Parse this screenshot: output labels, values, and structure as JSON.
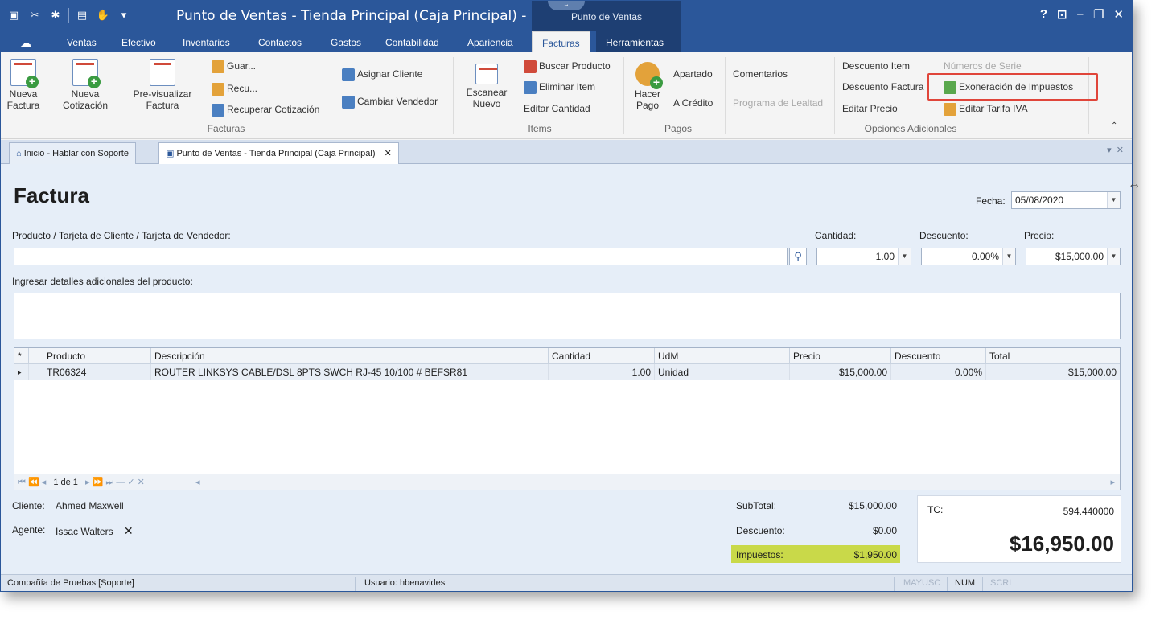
{
  "window": {
    "title": "Punto de Ventas - Tienda Principal (Caja Principal) - Finanz...",
    "context_tab": "Punto de Ventas",
    "controls": [
      "?",
      "⊡",
      "–",
      "🗗",
      "✕"
    ]
  },
  "ribbon_tabs": [
    "Ventas",
    "Efectivo",
    "Inventarios",
    "Contactos",
    "Gastos",
    "Contabilidad",
    "Apariencia",
    "Facturas",
    "Herramientas"
  ],
  "ribbon": {
    "facturas": {
      "nueva_factura": "Nueva\nFactura",
      "nueva_factura_l1": "Nueva",
      "nueva_factura_l2": "Factura",
      "nueva_cotizacion_l1": "Nueva",
      "nueva_cotizacion_l2": "Cotización",
      "previsualizar_l1": "Pre-visualizar",
      "previsualizar_l2": "Factura",
      "guardar": "Guar...",
      "recuperar": "Recu...",
      "recuperar_cotizacion": "Recuperar Cotización",
      "asignar_cliente": "Asignar Cliente",
      "cambiar_vendedor": "Cambiar Vendedor",
      "group_label": "Facturas"
    },
    "items": {
      "escanear_l1": "Escanear",
      "escanear_l2": "Nuevo",
      "buscar_producto": "Buscar Producto",
      "eliminar_item": "Eliminar Item",
      "editar_cantidad": "Editar Cantidad",
      "group_label": "Items"
    },
    "pagos": {
      "hacer_pago_l1": "Hacer",
      "hacer_pago_l2": "Pago",
      "apartado": "Apartado",
      "a_credito": "A Crédito",
      "group_label": "Pagos"
    },
    "opciones": {
      "comentarios": "Comentarios",
      "programa_lealtad": "Programa de Lealtad",
      "descuento_item": "Descuento Item",
      "descuento_factura": "Descuento Factura",
      "editar_precio": "Editar Precio",
      "numeros_serie": "Números de Serie",
      "exoneracion": "Exoneración de Impuestos",
      "editar_tarifa": "Editar Tarifa IVA",
      "group_label": "Opciones Adicionales"
    }
  },
  "doc_tabs": {
    "home": "Inicio - Hablar con Soporte",
    "active": "Punto de Ventas - Tienda Principal (Caja Principal)"
  },
  "form": {
    "heading": "Factura",
    "fecha_label": "Fecha:",
    "fecha_value": "05/08/2020",
    "producto_label": "Producto / Tarjeta de Cliente / Tarjeta de Vendedor:",
    "producto_value": "",
    "cantidad_label": "Cantidad:",
    "cantidad_value": "1.00",
    "descuento_label": "Descuento:",
    "descuento_value": "0.00%",
    "precio_label": "Precio:",
    "precio_value": "$15,000.00",
    "detalles_label": "Ingresar detalles adicionales del producto:",
    "detalles_value": ""
  },
  "grid": {
    "columns": [
      "*",
      "Producto",
      "Descripción",
      "Cantidad",
      "UdM",
      "Precio",
      "Descuento",
      "Total"
    ],
    "rows": [
      {
        "indicator": "▸",
        "producto": "TR06324",
        "descripcion": "ROUTER LINKSYS CABLE/DSL 8PTS SWCH RJ-45 10/100 # BEFSR81",
        "cantidad": "1.00",
        "udm": "Unidad",
        "precio": "$15,000.00",
        "descuento": "0.00%",
        "total": "$15,000.00"
      }
    ],
    "pager": "1 de 1"
  },
  "footer": {
    "cliente_label": "Cliente:",
    "cliente_value": "Ahmed Maxwell",
    "agente_label": "Agente:",
    "agente_value": "Issac Walters",
    "subtotal_label": "SubTotal:",
    "subtotal_value": "$15,000.00",
    "descuento_label": "Descuento:",
    "descuento_value": "$0.00",
    "impuestos_label": "Impuestos:",
    "impuestos_value": "$1,950.00",
    "tc_label": "TC:",
    "tc_value": "594.440000",
    "grand_total": "$16,950.00"
  },
  "statusbar": {
    "company": "Compañía de Pruebas [Soporte]",
    "user": "Usuario: hbenavides",
    "mayusc": "MAYUSC",
    "num": "NUM",
    "scrl": "SCRL"
  },
  "colors": {
    "titlebar": "#2b579a",
    "context_tab": "#1e3f73",
    "highlight_box": "#e0453a",
    "tax_highlight": "#c9d949"
  }
}
